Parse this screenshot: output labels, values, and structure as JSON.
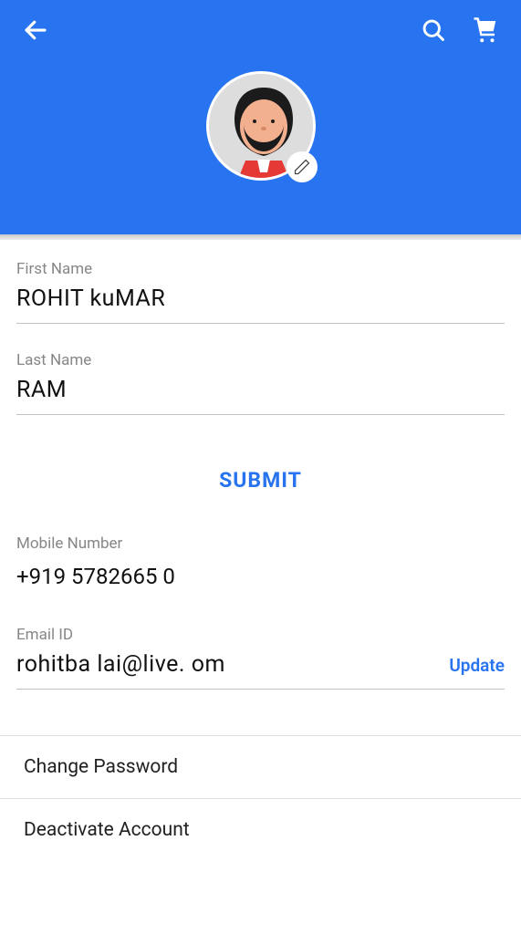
{
  "header": {
    "colors": {
      "primary": "#2874f0"
    }
  },
  "form": {
    "firstName": {
      "label": "First Name",
      "value": "ROHIT kuMAR"
    },
    "lastName": {
      "label": "Last Name",
      "value": "RAM"
    },
    "submit": "SUBMIT",
    "mobile": {
      "label": "Mobile Number",
      "value": "+919  5782665 0"
    },
    "email": {
      "label": "Email ID",
      "value": "rohitba    lai@live. om",
      "updateLabel": "Update"
    }
  },
  "menu": {
    "changePassword": "Change Password",
    "deactivate": "Deactivate Account"
  }
}
